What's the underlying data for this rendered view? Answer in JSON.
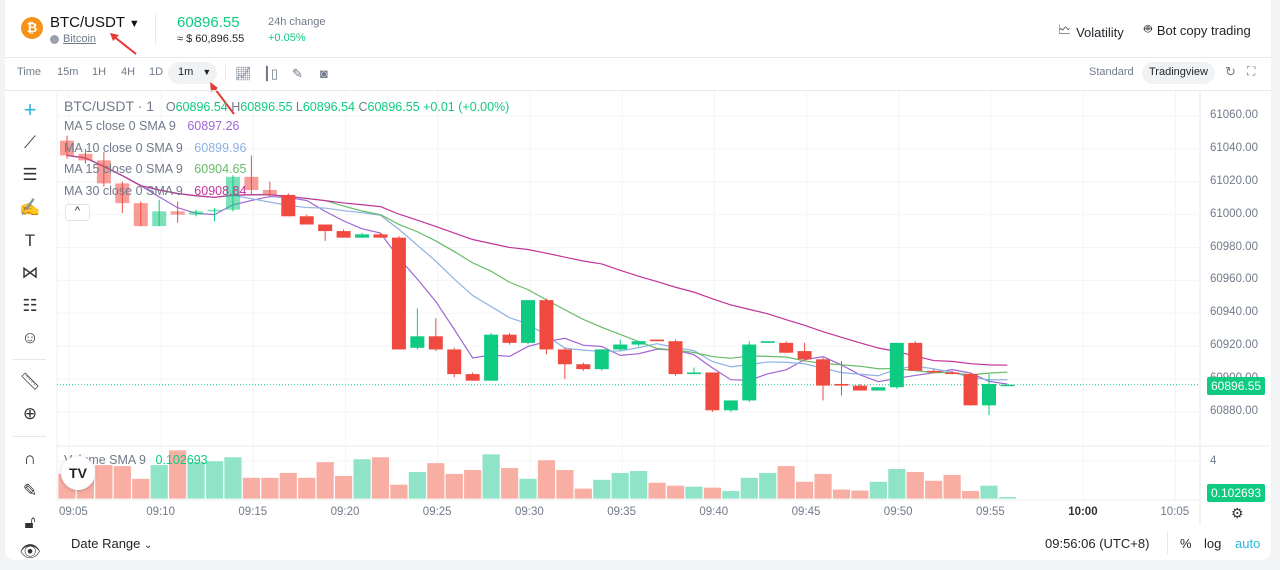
{
  "header": {
    "symbol": "BTC/USDT",
    "coin_name": "Bitcoin",
    "last_price": "60896.55",
    "usd_price": "≈ $ 60,896.55",
    "change_label": "24h change",
    "change_value": "+0.05%",
    "volatility": "Volatility",
    "bot": "Bot copy trading"
  },
  "toolbar": {
    "intervals": [
      "Time",
      "15m",
      "1H",
      "4H",
      "1D"
    ],
    "selected_interval": "1m",
    "views": [
      "Standard",
      "Tradingview"
    ],
    "active_view": "Tradingview"
  },
  "left_tools": [
    "crosshair-icon",
    "trend-line-icon",
    "parallel-channel-icon",
    "brush-icon",
    "text-icon",
    "pattern-icon",
    "forecast-icon",
    "emoji-icon",
    "ruler-icon",
    "zoom-in-icon",
    "magnet-icon",
    "lock-drawing-icon",
    "unlock-icon",
    "eye-icon"
  ],
  "legend": {
    "title": "BTC/USDT · 1",
    "o_label": "O",
    "o": "60896.54",
    "h_label": "H",
    "h": "60896.55",
    "l_label": "L",
    "l": "60896.54",
    "c_label": "C",
    "c": "60896.55",
    "change": "+0.01 (+0.00%)",
    "ma": [
      {
        "label": "MA 5 close 0 SMA 9",
        "value": "60897.26",
        "color": "#a066d3"
      },
      {
        "label": "MA 10 close 0 SMA 9",
        "value": "60899.96",
        "color": "#8fb1e3"
      },
      {
        "label": "MA 15 close 0 SMA 9",
        "value": "60904.65",
        "color": "#66bb6a"
      },
      {
        "label": "MA 30 close 0 SMA 9",
        "value": "60908.84",
        "color": "#c2339a"
      }
    ],
    "volume_label": "Volume SMA 9",
    "volume_value": "0.102693"
  },
  "price_axis": {
    "ticks": [
      "61060.00",
      "61040.00",
      "61020.00",
      "61000.00",
      "60980.00",
      "60960.00",
      "60940.00",
      "60920.00",
      "60900.00",
      "60880.00"
    ],
    "current": "60896.55",
    "volume_tick": "4",
    "volume_current": "0.102693"
  },
  "time_axis": [
    "09:05",
    "09:10",
    "09:15",
    "09:20",
    "09:25",
    "09:30",
    "09:35",
    "09:40",
    "09:45",
    "09:50",
    "09:55",
    "10:00",
    "10:05"
  ],
  "footer": {
    "date_range": "Date Range",
    "clock": "09:56:06 (UTC+8)",
    "pct": "%",
    "log": "log",
    "auto": "auto"
  },
  "colors": {
    "up": "#0ecb81",
    "down": "#f6465d",
    "accent": "#2fb5d9"
  },
  "chart_data": {
    "type": "candlestick",
    "interval": "1m",
    "x_start": "09:05",
    "ylim": [
      60870,
      61070
    ],
    "ohlc": [
      [
        61045,
        61048,
        61034,
        61036
      ],
      [
        61037,
        61040,
        61031,
        61033
      ],
      [
        61033,
        61038,
        61017,
        61019
      ],
      [
        61019,
        61020,
        61001,
        61007
      ],
      [
        61007,
        61008,
        60993,
        60993
      ],
      [
        60993,
        61009,
        60993,
        61002
      ],
      [
        61002,
        61008,
        60995,
        61000
      ],
      [
        61000,
        61003,
        60999,
        61002
      ],
      [
        61002,
        61004,
        60996,
        61003
      ],
      [
        61003,
        61024,
        61002,
        61023
      ],
      [
        61023,
        61036,
        61012,
        61015
      ],
      [
        61015,
        61020,
        61011,
        61012
      ],
      [
        61012,
        61013,
        60999,
        60999
      ],
      [
        60999,
        61000,
        60994,
        60994
      ],
      [
        60994,
        60994,
        60984,
        60990
      ],
      [
        60990,
        60991,
        60986,
        60986
      ],
      [
        60986,
        60989,
        60986,
        60988
      ],
      [
        60988,
        60989,
        60986,
        60986
      ],
      [
        60986,
        60987,
        60918,
        60918
      ],
      [
        60919,
        60943,
        60918,
        60926
      ],
      [
        60926,
        60937,
        60917,
        60918
      ],
      [
        60918,
        60919,
        60901,
        60903
      ],
      [
        60903,
        60904,
        60899,
        60899
      ],
      [
        60899,
        60928,
        60899,
        60927
      ],
      [
        60927,
        60928,
        60921,
        60922
      ],
      [
        60922,
        60948,
        60921,
        60948
      ],
      [
        60948,
        60949,
        60915,
        60918
      ],
      [
        60918,
        60919,
        60900,
        60909
      ],
      [
        60909,
        60910,
        60905,
        60906
      ],
      [
        60906,
        60918,
        60905,
        60918
      ],
      [
        60918,
        60924,
        60917,
        60921
      ],
      [
        60921,
        60923,
        60920,
        60923
      ],
      [
        60924,
        60924,
        60923,
        60923
      ],
      [
        60923,
        60924,
        60902,
        60903
      ],
      [
        60903,
        60907,
        60903,
        60904
      ],
      [
        60904,
        60904,
        60880,
        60881
      ],
      [
        60881,
        60887,
        60880,
        60887
      ],
      [
        60887,
        60923,
        60886,
        60921
      ],
      [
        60922,
        60923,
        60922,
        60923
      ],
      [
        60922,
        60923,
        60916,
        60916
      ],
      [
        60917,
        60922,
        60911,
        60912
      ],
      [
        60912,
        60913,
        60887,
        60896
      ],
      [
        60897,
        60911,
        60890,
        60896
      ],
      [
        60896,
        60897,
        60893,
        60893
      ],
      [
        60893,
        60895,
        60893,
        60895
      ],
      [
        60895,
        60922,
        60894,
        60922
      ],
      [
        60922,
        60923,
        60905,
        60905
      ],
      [
        60905,
        60906,
        60904,
        60904
      ],
      [
        60904,
        60905,
        60903,
        60903
      ],
      [
        60903,
        60904,
        60884,
        60884
      ],
      [
        60884,
        60903,
        60878,
        60897
      ],
      [
        60896.54,
        60896.55,
        60896.54,
        60896.55
      ]
    ],
    "volume": [
      2.6,
      2.9,
      3.5,
      3.4,
      2.1,
      3.5,
      5.0,
      3.8,
      3.9,
      4.3,
      2.2,
      2.2,
      2.7,
      2.2,
      3.8,
      2.4,
      4.1,
      4.3,
      1.5,
      2.8,
      3.7,
      2.6,
      3.0,
      4.6,
      3.2,
      2.1,
      4.0,
      3.0,
      1.1,
      2.0,
      2.7,
      2.9,
      1.7,
      1.4,
      1.3,
      1.2,
      0.85,
      2.2,
      2.7,
      3.4,
      1.8,
      2.6,
      1.0,
      0.9,
      1.8,
      3.1,
      2.8,
      1.9,
      2.5,
      0.85,
      1.4,
      0.24
    ],
    "ma_periods": [
      5,
      10,
      15,
      30
    ]
  }
}
